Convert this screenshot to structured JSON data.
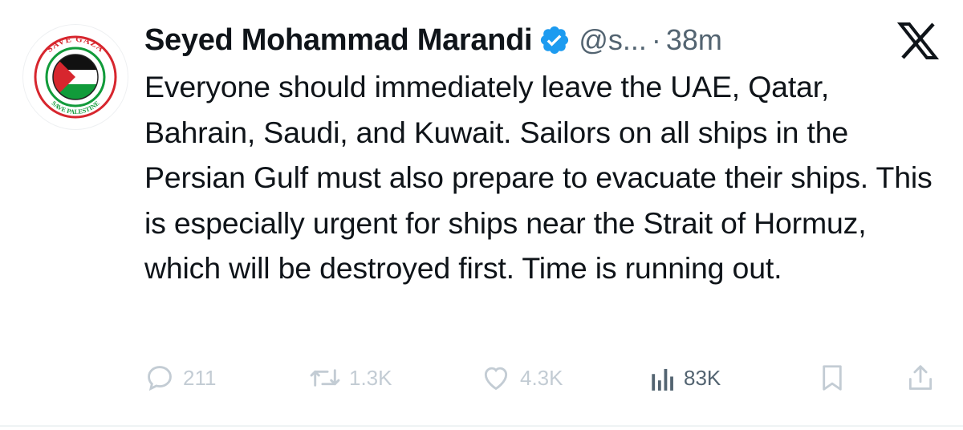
{
  "tweet": {
    "author_name": "Seyed Mohammad Marandi",
    "handle": "@s...",
    "separator": "·",
    "time": "38m",
    "text": "Everyone should immediately leave the UAE, Qatar, Bahrain, Saudi, and Kuwait. Sailors on all ships in the Persian Gulf must also prepare to evacuate their ships. This is especially urgent for ships near the Strait of Hormuz, which will be destroyed first. Time is running out.",
    "avatar": {
      "text_top": "SAVE GAZA",
      "text_bottom": "SAVE PALESTINE"
    }
  },
  "actions": {
    "replies": "211",
    "reposts": "1.3K",
    "likes": "4.3K",
    "views": "83K"
  },
  "icons": {
    "verified": "verified-badge-icon",
    "brand": "x-logo-icon",
    "reply": "reply-icon",
    "repost": "repost-icon",
    "like": "heart-icon",
    "views": "views-icon",
    "bookmark": "bookmark-icon",
    "share": "share-icon"
  },
  "colors": {
    "text": "#0f1419",
    "secondary": "#536471",
    "faded": "#c3ccd4",
    "verified": "#1d9bf0",
    "palestine_red": "#d7262e",
    "palestine_green": "#119b3a"
  }
}
